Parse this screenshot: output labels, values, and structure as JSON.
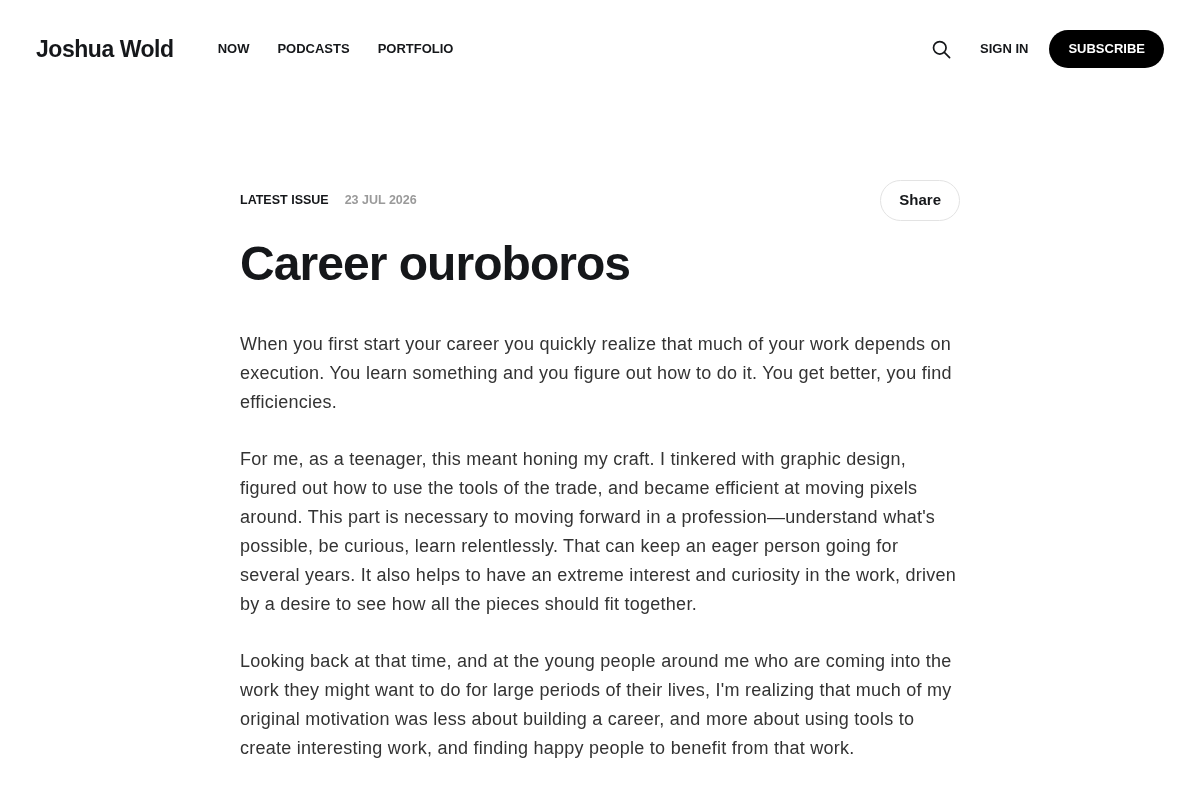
{
  "header": {
    "logo": "Joshua Wold",
    "nav": [
      "NOW",
      "PODCASTS",
      "PORTFOLIO"
    ],
    "sign_in": "SIGN IN",
    "subscribe": "SUBSCRIBE"
  },
  "article": {
    "tag": "LATEST ISSUE",
    "date": "23 JUL 2026",
    "share": "Share",
    "title": "Career ouroboros",
    "paragraphs": [
      "When you first start your career you quickly realize that much of your work depends on execution. You learn something and you figure out how to do it. You get better, you find efficiencies.",
      "For me, as a teenager, this meant honing my craft. I tinkered with graphic design, figured out how to use the tools of the trade, and became efficient at moving pixels around. This part is necessary to moving forward in a profession—understand what's possible, be curious, learn relentlessly. That can keep an eager person going for several years. It also helps to have an extreme interest and curiosity in the work, driven by a desire to see how all the pieces should fit together.",
      "Looking back at that time, and at the young people around me who are coming into the work they might want to do for large periods of their lives, I'm realizing that much of my original motivation was less about building a career, and more about using tools to create interesting work, and finding happy people to benefit from that work."
    ]
  }
}
